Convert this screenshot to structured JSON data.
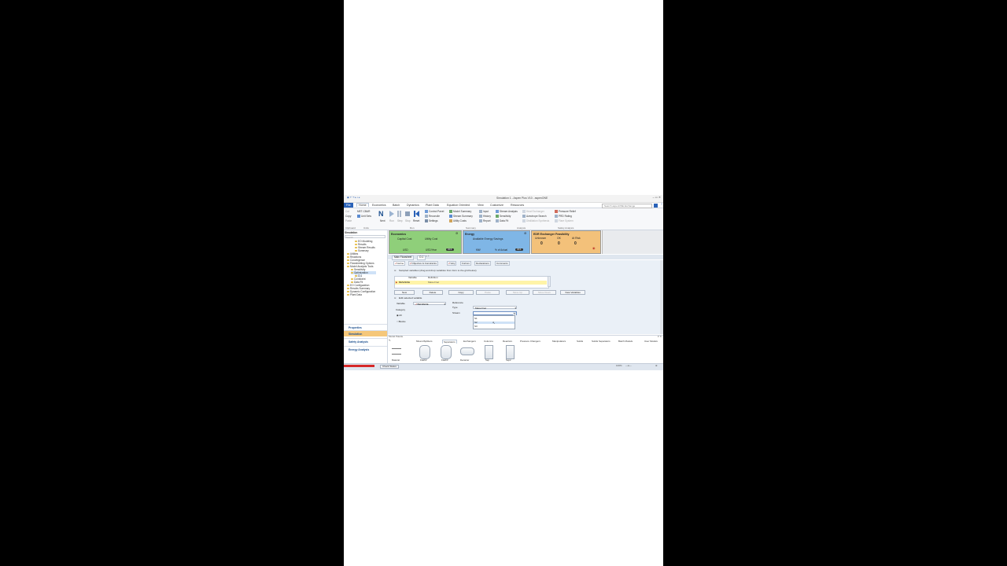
{
  "window": {
    "title": "Simulation 1 - Aspen Plus V10 - aspenONE"
  },
  "menu": {
    "file": "File",
    "tabs": [
      "Home",
      "Economics",
      "Batch",
      "Dynamics",
      "Plant Data",
      "Equation Oriented",
      "View",
      "Customize",
      "Resources"
    ],
    "search_placeholder": "Search aspenONE Exchange"
  },
  "ribbon": {
    "clipboard": {
      "cut": "Cut",
      "copy": "Copy",
      "paste": "Paste",
      "group": "Clipboard"
    },
    "units": {
      "selector": "MET-CBAR",
      "unit_sets": "Unit Sets",
      "group": "Units"
    },
    "run": {
      "next": "Next",
      "run": "Run",
      "step": "Step",
      "stop": "Stop",
      "reset": "Reset",
      "group": "Run"
    },
    "run_items": [
      "Control Panel",
      "Reconcile",
      "Settings"
    ],
    "summary_items": [
      "Model Summary",
      "Stream Summary",
      "Utility Costs"
    ],
    "summary2_items": [
      "Input",
      "History",
      "Report"
    ],
    "summary_group": "Summary",
    "analysis_items": [
      "Stream Analysis",
      "Sensitivity",
      "Data Fit"
    ],
    "analysis_group": "Analysis",
    "heat_items": [
      "Heat Exchanger",
      "Azeotrope Search",
      "Distillation Synthesis"
    ],
    "safety_items": [
      "Pressure Relief",
      "PRD Rating",
      "Flare System"
    ],
    "safety_group": "Safety Analysis"
  },
  "nav": {
    "title": "Simulation",
    "search_placeholder": "Search",
    "items": [
      "EO Modeling",
      "Results",
      "Stream Results",
      "Summary",
      "Utilities",
      "Reactions",
      "Convergence",
      "Flowsheeting Options",
      "Model Analysis Tools",
      "Sensitivity",
      "Optimization",
      "O-1",
      "Constraint",
      "Data Fit",
      "EO Configuration",
      "Results Summary",
      "Dynamic Configuration",
      "Plant Data"
    ],
    "buttons": [
      "Properties",
      "Simulation",
      "Safety Analysis",
      "Energy Analysis"
    ]
  },
  "cards": {
    "economics": {
      "title": "Economics",
      "capital": "Capital Cost",
      "utility": "Utility Cost",
      "capital_unit": "USD",
      "utility_unit": "USD/Year",
      "toggle": "OFF",
      "color": "#8fcf7a"
    },
    "energy": {
      "title": "Energy",
      "savings": "Available Energy Savings",
      "unit1": "MW",
      "unit2": "% of Actual",
      "toggle": "OFF",
      "color": "#7fb6e6"
    },
    "edr": {
      "title": "EDR Exchanger Feasibility",
      "col1": "Unknown",
      "col2": "OK",
      "col3": "At Risk",
      "v1": "0",
      "v2": "0",
      "v3": "0",
      "color": "#f3c17a"
    }
  },
  "doc_tabs": [
    "Main Flowsheet",
    "O-1"
  ],
  "form": {
    "tabs": [
      "Define",
      "Objective & Constraints",
      "Vary",
      "Fortran",
      "Declarations",
      "Comments"
    ],
    "hint": "Sampled variables (drag and drop variables from form to the grid below)",
    "grid_headers": [
      "Variable",
      "Definition"
    ],
    "grid_row": {
      "variable": "BENZENE",
      "definition": "Mass-Frac"
    },
    "buttons": [
      "New",
      "Delete",
      "Copy",
      "Paste",
      "Move Up",
      "Move Down",
      "View Variables"
    ],
    "edit_label": "Edit selected variable",
    "variable_label": "Variable",
    "variable_value": "BENZENE",
    "reference_label": "Reference",
    "category_label": "Category",
    "type_label": "Type",
    "type_value": "Mass-Frac",
    "stream_label": "Stream",
    "all_label": "All",
    "blocks_label": "Blocks",
    "dropdown_options": [
      "S1",
      "S2",
      "S3"
    ]
  },
  "palette": {
    "title": "Model Palette",
    "tabs": [
      "Mixers/Splitters",
      "Separators",
      "Exchangers",
      "Columns",
      "Reactors",
      "Pressure Changers",
      "Manipulators",
      "Solids",
      "Solids Separators",
      "Batch Models",
      "User Models"
    ],
    "models": [
      "Material",
      "Flash2",
      "Flash3",
      "Decanter",
      "Sep",
      "Sep2"
    ]
  },
  "status": {
    "check": "Check Status",
    "zoom": "100%"
  }
}
